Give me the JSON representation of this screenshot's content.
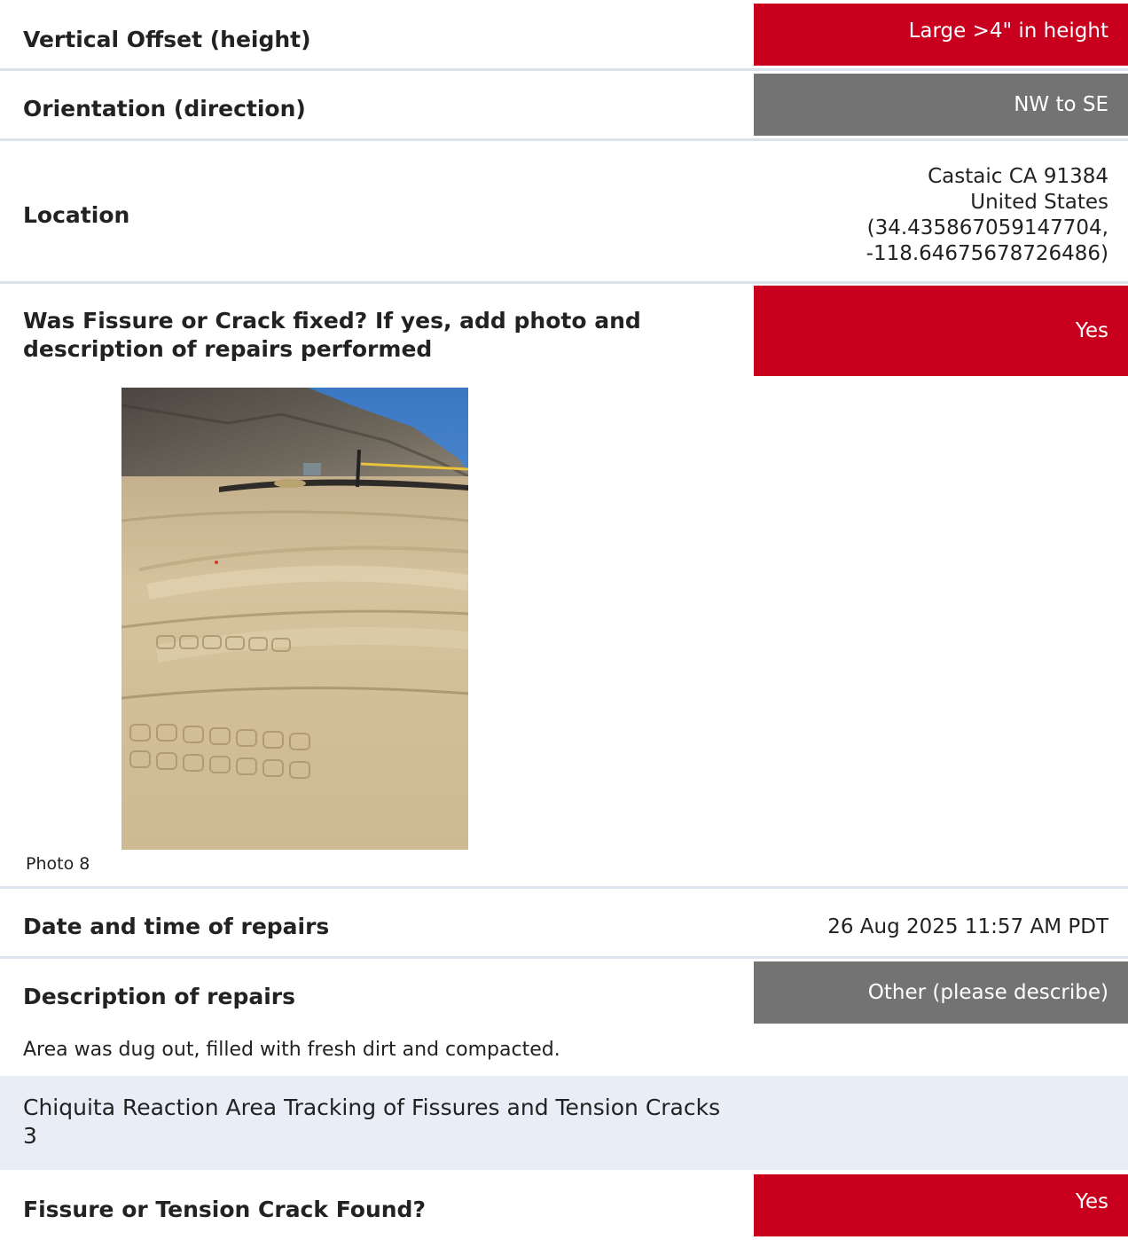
{
  "rows": {
    "vertical_offset": {
      "label": "Vertical Offset (height)",
      "value": "Large >4\" in height",
      "color": "#c8001e"
    },
    "orientation": {
      "label": "Orientation (direction)",
      "value": "NW to SE",
      "color": "#737373"
    },
    "location": {
      "label": "Location",
      "lines": [
        "Castaic CA 91384",
        "United States",
        "(34.435867059147704,",
        "-118.64675678726486)"
      ]
    },
    "fixed": {
      "label": "Was Fissure or Crack fixed? If yes, add photo and description of repairs performed",
      "value": "Yes",
      "color": "#c8001e"
    },
    "photo": {
      "caption": "Photo 8"
    },
    "repair_datetime": {
      "label": "Date and time of repairs",
      "value": "26 Aug 2025 11:57 AM PDT"
    },
    "repair_description": {
      "label": "Description of repairs",
      "value": "Other (please describe)",
      "color": "#737373",
      "text": "Area was dug out, filled with fresh dirt and compacted."
    }
  },
  "section": {
    "title": "Chiquita Reaction Area Tracking of Fissures and Tension Cracks 3"
  },
  "found": {
    "label": "Fissure or Tension Crack Found?",
    "value": "Yes",
    "color": "#c8001e"
  }
}
